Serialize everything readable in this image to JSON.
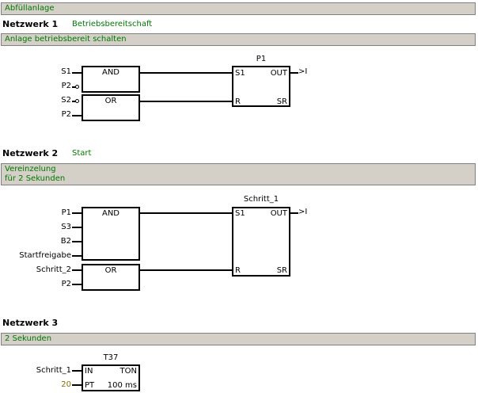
{
  "title_bar": "Abfüllanlage",
  "networks": [
    {
      "label": "Netzwerk 1",
      "comment": "Betriebsbereitschaft",
      "description": "Anlage betriebsbereit schalten",
      "gates": {
        "and": {
          "label": "AND",
          "inputs": [
            "S1",
            "P2"
          ]
        },
        "or": {
          "label": "OR",
          "inputs": [
            "S2",
            "P2"
          ]
        }
      },
      "block": {
        "name": "P1",
        "s": "S1",
        "r": "R",
        "out": "OUT",
        "sr": "SR",
        "coil": ">I"
      }
    },
    {
      "label": "Netzwerk 2",
      "comment": "Start",
      "description": "Vereinzelung\nfür 2 Sekunden",
      "gates": {
        "and": {
          "label": "AND",
          "inputs": [
            "P1",
            "S3",
            "B2",
            "Startfreigabe"
          ]
        },
        "or": {
          "label": "OR",
          "inputs": [
            "Schritt_2",
            "P2"
          ]
        }
      },
      "block": {
        "name": "Schritt_1",
        "s": "S1",
        "r": "R",
        "out": "OUT",
        "sr": "SR",
        "coil": ">I"
      }
    },
    {
      "label": "Netzwerk 3",
      "comment": "",
      "description": "2 Sekunden",
      "timer": {
        "name": "T37",
        "in_label": "IN",
        "type": "TON",
        "pt_label": "PT",
        "pt_unit": "100 ms",
        "in_signal": "Schritt_1",
        "pt_value": "20"
      }
    }
  ]
}
